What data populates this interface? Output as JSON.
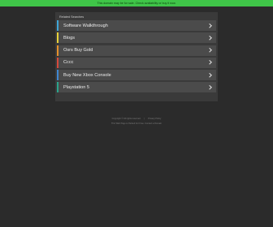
{
  "banner": {
    "text": "This domain may be for sale. Check availability or buy it now."
  },
  "panel": {
    "title": "Related Searches",
    "items": [
      {
        "label": "Software Walkthrough",
        "color": "#3fa6d8"
      },
      {
        "label": "Blogs",
        "color": "#e7d23a"
      },
      {
        "label": "Osrs Buy Gold",
        "color": "#e4902b"
      },
      {
        "label": "Cccc",
        "color": "#d6493c"
      },
      {
        "label": "Buy New Xbox Console",
        "color": "#3f87d2"
      },
      {
        "label": "Playstation 5",
        "color": "#2aa48c"
      }
    ]
  },
  "footer": {
    "copyright": "Copyright © All rights reserved.",
    "privacy_link": "Privacy Policy",
    "line2": "This Web Page is Parked For Free. Contact a Domain"
  }
}
